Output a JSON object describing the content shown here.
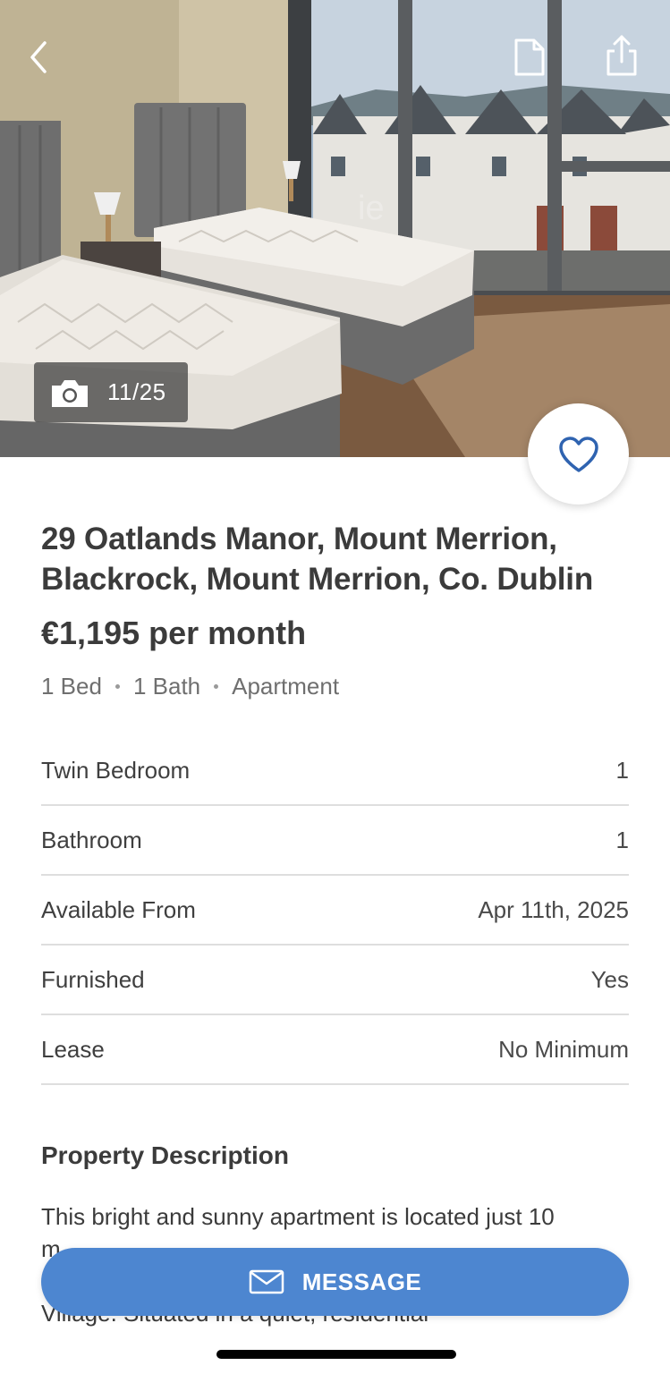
{
  "gallery": {
    "current": "11",
    "total": "25",
    "counter_text": "11/25",
    "watermark": "ie"
  },
  "icons": {
    "back": "chevron-left-icon",
    "save": "document-icon",
    "share": "share-icon",
    "camera": "camera-icon",
    "favourite": "heart-outline-icon",
    "message": "envelope-icon"
  },
  "listing": {
    "address": "29 Oatlands Manor, Mount Merrion, Blackrock, Mount Merrion, Co. Dublin",
    "price": "€1,195 per month",
    "beds": "1 Bed",
    "baths": "1 Bath",
    "type": "Apartment"
  },
  "details": [
    {
      "label": "Twin Bedroom",
      "value": "1"
    },
    {
      "label": "Bathroom",
      "value": "1"
    },
    {
      "label": "Available From",
      "value": "Apr 11th, 2025"
    },
    {
      "label": "Furnished",
      "value": "Yes"
    },
    {
      "label": "Lease",
      "value": "No Minimum"
    }
  ],
  "description": {
    "title": "Property Description",
    "line1": "This bright and sunny apartment is located just 10",
    "line2": "m",
    "line3": "(",
    "line4": "Village. Situated in a quiet, residential"
  },
  "actions": {
    "message_label": "MESSAGE"
  },
  "colors": {
    "accent": "#4d86d0",
    "heart": "#2f63b0",
    "divider": "#dedede"
  }
}
